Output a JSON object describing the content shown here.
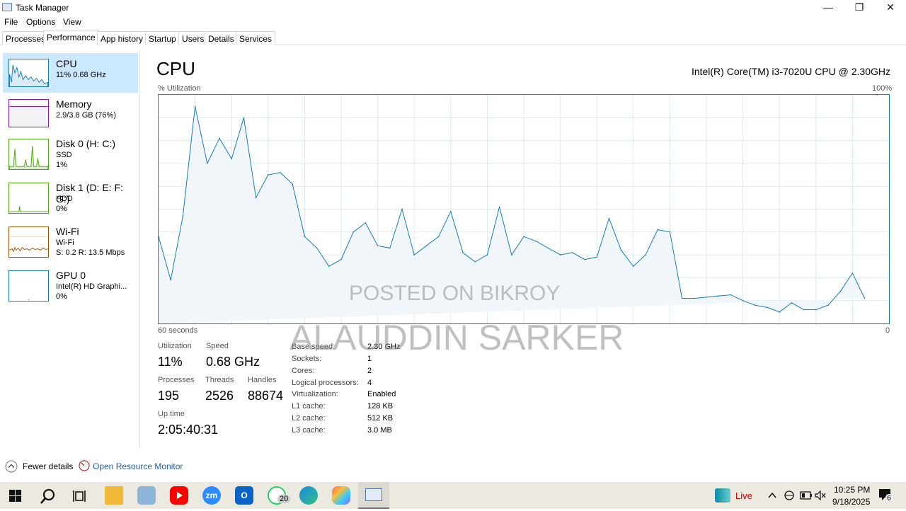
{
  "window": {
    "title": "Task Manager",
    "minimize": "—",
    "maximize": "❐",
    "close": "✕"
  },
  "menu": [
    "File",
    "Options",
    "View"
  ],
  "tabs": [
    "Processes",
    "Performance",
    "App history",
    "Startup",
    "Users",
    "Details",
    "Services"
  ],
  "sidebar": [
    {
      "name": "CPU",
      "sub1": "11%  0.68 GHz",
      "sub2": "",
      "sub3": ""
    },
    {
      "name": "Memory",
      "sub1": "2.9/3.8 GB (76%)",
      "sub2": "",
      "sub3": ""
    },
    {
      "name": "Disk 0 (H: C:)",
      "sub1": "SSD",
      "sub2": "1%",
      "sub3": ""
    },
    {
      "name": "Disk 1 (D: E: F: G:)",
      "sub1": "HDD",
      "sub2": "0%",
      "sub3": ""
    },
    {
      "name": "Wi-Fi",
      "sub1": "Wi-Fi",
      "sub2": "S: 0.2  R: 13.5 Mbps",
      "sub3": ""
    },
    {
      "name": "GPU 0",
      "sub1": "Intel(R) HD Graphi...",
      "sub2": "0%",
      "sub3": ""
    }
  ],
  "main": {
    "title": "CPU",
    "model": "Intel(R) Core(TM) i3-7020U CPU @ 2.30GHz",
    "y_label": "% Utilization",
    "y_max_label": "100%",
    "x_left_label": "60 seconds",
    "x_right_label": "0"
  },
  "chart_data": {
    "type": "area",
    "ylim": [
      0,
      100
    ],
    "xlim": [
      60,
      0
    ],
    "x": [
      60,
      59,
      58,
      57,
      56,
      55,
      54,
      53,
      52,
      51,
      50,
      49,
      48,
      47,
      46,
      45,
      44,
      43,
      42,
      41,
      40,
      39,
      38,
      37,
      36,
      35,
      34,
      33,
      32,
      31,
      30,
      29,
      28,
      27,
      26,
      25,
      24,
      23,
      22,
      21,
      20,
      19,
      18,
      17,
      16,
      15,
      14,
      13,
      12,
      11,
      10,
      9,
      8,
      7,
      6,
      5,
      4,
      3,
      2,
      1,
      0
    ],
    "values": [
      38,
      19,
      47,
      95,
      70,
      81,
      72,
      90,
      55,
      65,
      66,
      61,
      38,
      33,
      25,
      28,
      40,
      44,
      34,
      33,
      50,
      30,
      34,
      38,
      49,
      31,
      27,
      30,
      51,
      30,
      38,
      36,
      33,
      30,
      31,
      28,
      29,
      46,
      32,
      25,
      30,
      41,
      40,
      11,
      11,
      11.5,
      12,
      12.5,
      10,
      8,
      7,
      5,
      9,
      6,
      6,
      8,
      14,
      22,
      11
    ]
  },
  "stats": {
    "utilization_label": "Utilization",
    "utilization": "11%",
    "speed_label": "Speed",
    "speed": "0.68 GHz",
    "processes_label": "Processes",
    "processes": "195",
    "threads_label": "Threads",
    "threads": "2526",
    "handles_label": "Handles",
    "handles": "88674",
    "uptime_label": "Up time",
    "uptime": "2:05:40:31"
  },
  "specs": [
    {
      "k": "Base speed:",
      "v": "2.30 GHz"
    },
    {
      "k": "Sockets:",
      "v": "1"
    },
    {
      "k": "Cores:",
      "v": "2"
    },
    {
      "k": "Logical processors:",
      "v": "4"
    },
    {
      "k": "Virtualization:",
      "v": "Enabled"
    },
    {
      "k": "L1 cache:",
      "v": "128 KB"
    },
    {
      "k": "L2 cache:",
      "v": "512 KB"
    },
    {
      "k": "L3 cache:",
      "v": "3.0 MB"
    }
  ],
  "watermark": {
    "line1": "POSTED ON BIKROY",
    "line2": "ALAUDDIN SARKER"
  },
  "footer": {
    "fewer": "Fewer details",
    "resmon": "Open Resource Monitor"
  },
  "taskbar": {
    "live": "Live",
    "time": "10:25 PM",
    "date": "9/18/2025",
    "whatsapp_badge": "20",
    "notif_badge": "6",
    "zoom_label": "zm"
  },
  "colors": {
    "accent": "#117dbb",
    "selected": "#cce8ff",
    "memory": "#8b12ae",
    "disk": "#4da60c",
    "wifi": "#a74f01"
  }
}
